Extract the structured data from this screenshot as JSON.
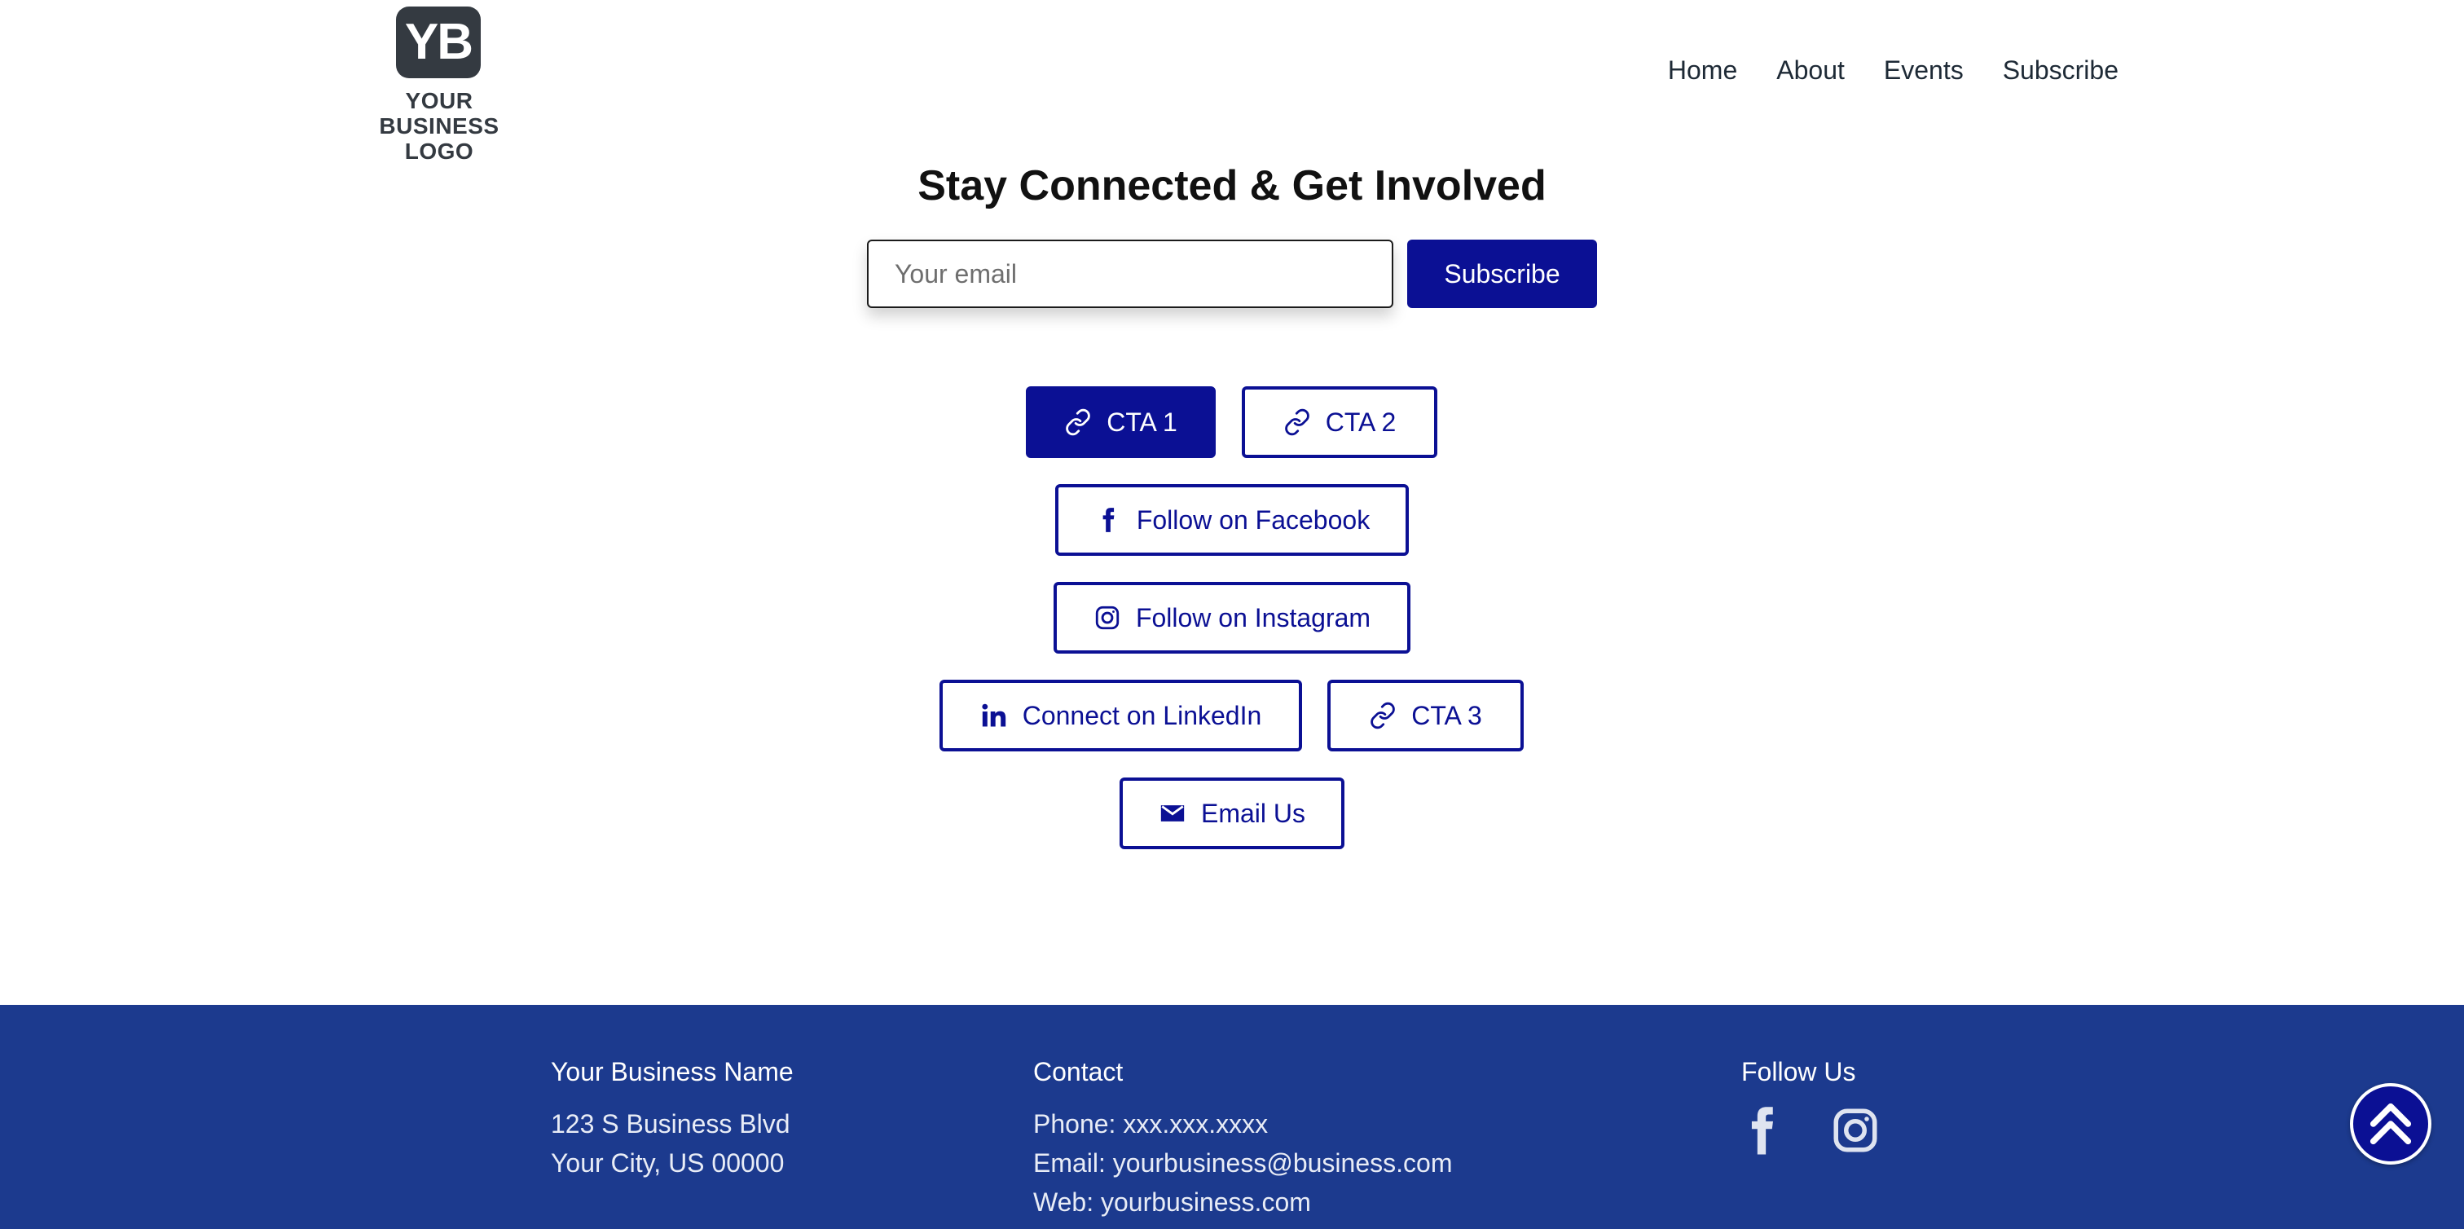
{
  "header": {
    "logo_mark": "YB",
    "logo_text": "YOUR BUSINESS LOGO",
    "nav": [
      "Home",
      "About",
      "Events",
      "Subscribe"
    ]
  },
  "hero": {
    "headline": "Stay Connected & Get Involved",
    "email_placeholder": "Your email",
    "subscribe_label": "Subscribe"
  },
  "buttons": {
    "cta1": "CTA 1",
    "cta2": "CTA 2",
    "facebook": "Follow on Facebook",
    "instagram": "Follow on Instagram",
    "linkedin": "Connect on LinkedIn",
    "cta3": "CTA 3",
    "email": "Email Us"
  },
  "footer": {
    "business_heading": "Your Business Name",
    "address_line1": "123 S Business Blvd",
    "address_line2": "Your City, US 00000",
    "contact_heading": "Contact",
    "phone": "Phone: xxx.xxx.xxxx",
    "email": "Email: yourbusiness@business.com",
    "web": "Web: yourbusiness.com",
    "follow_heading": "Follow Us"
  },
  "icons": [
    "link-icon",
    "facebook-icon",
    "instagram-icon",
    "linkedin-icon",
    "mail-icon",
    "double-chevron-up-icon"
  ],
  "colors": {
    "primary": "#0b1094",
    "footer_bg": "#1c3a8e",
    "logo_bg": "#343a41"
  }
}
